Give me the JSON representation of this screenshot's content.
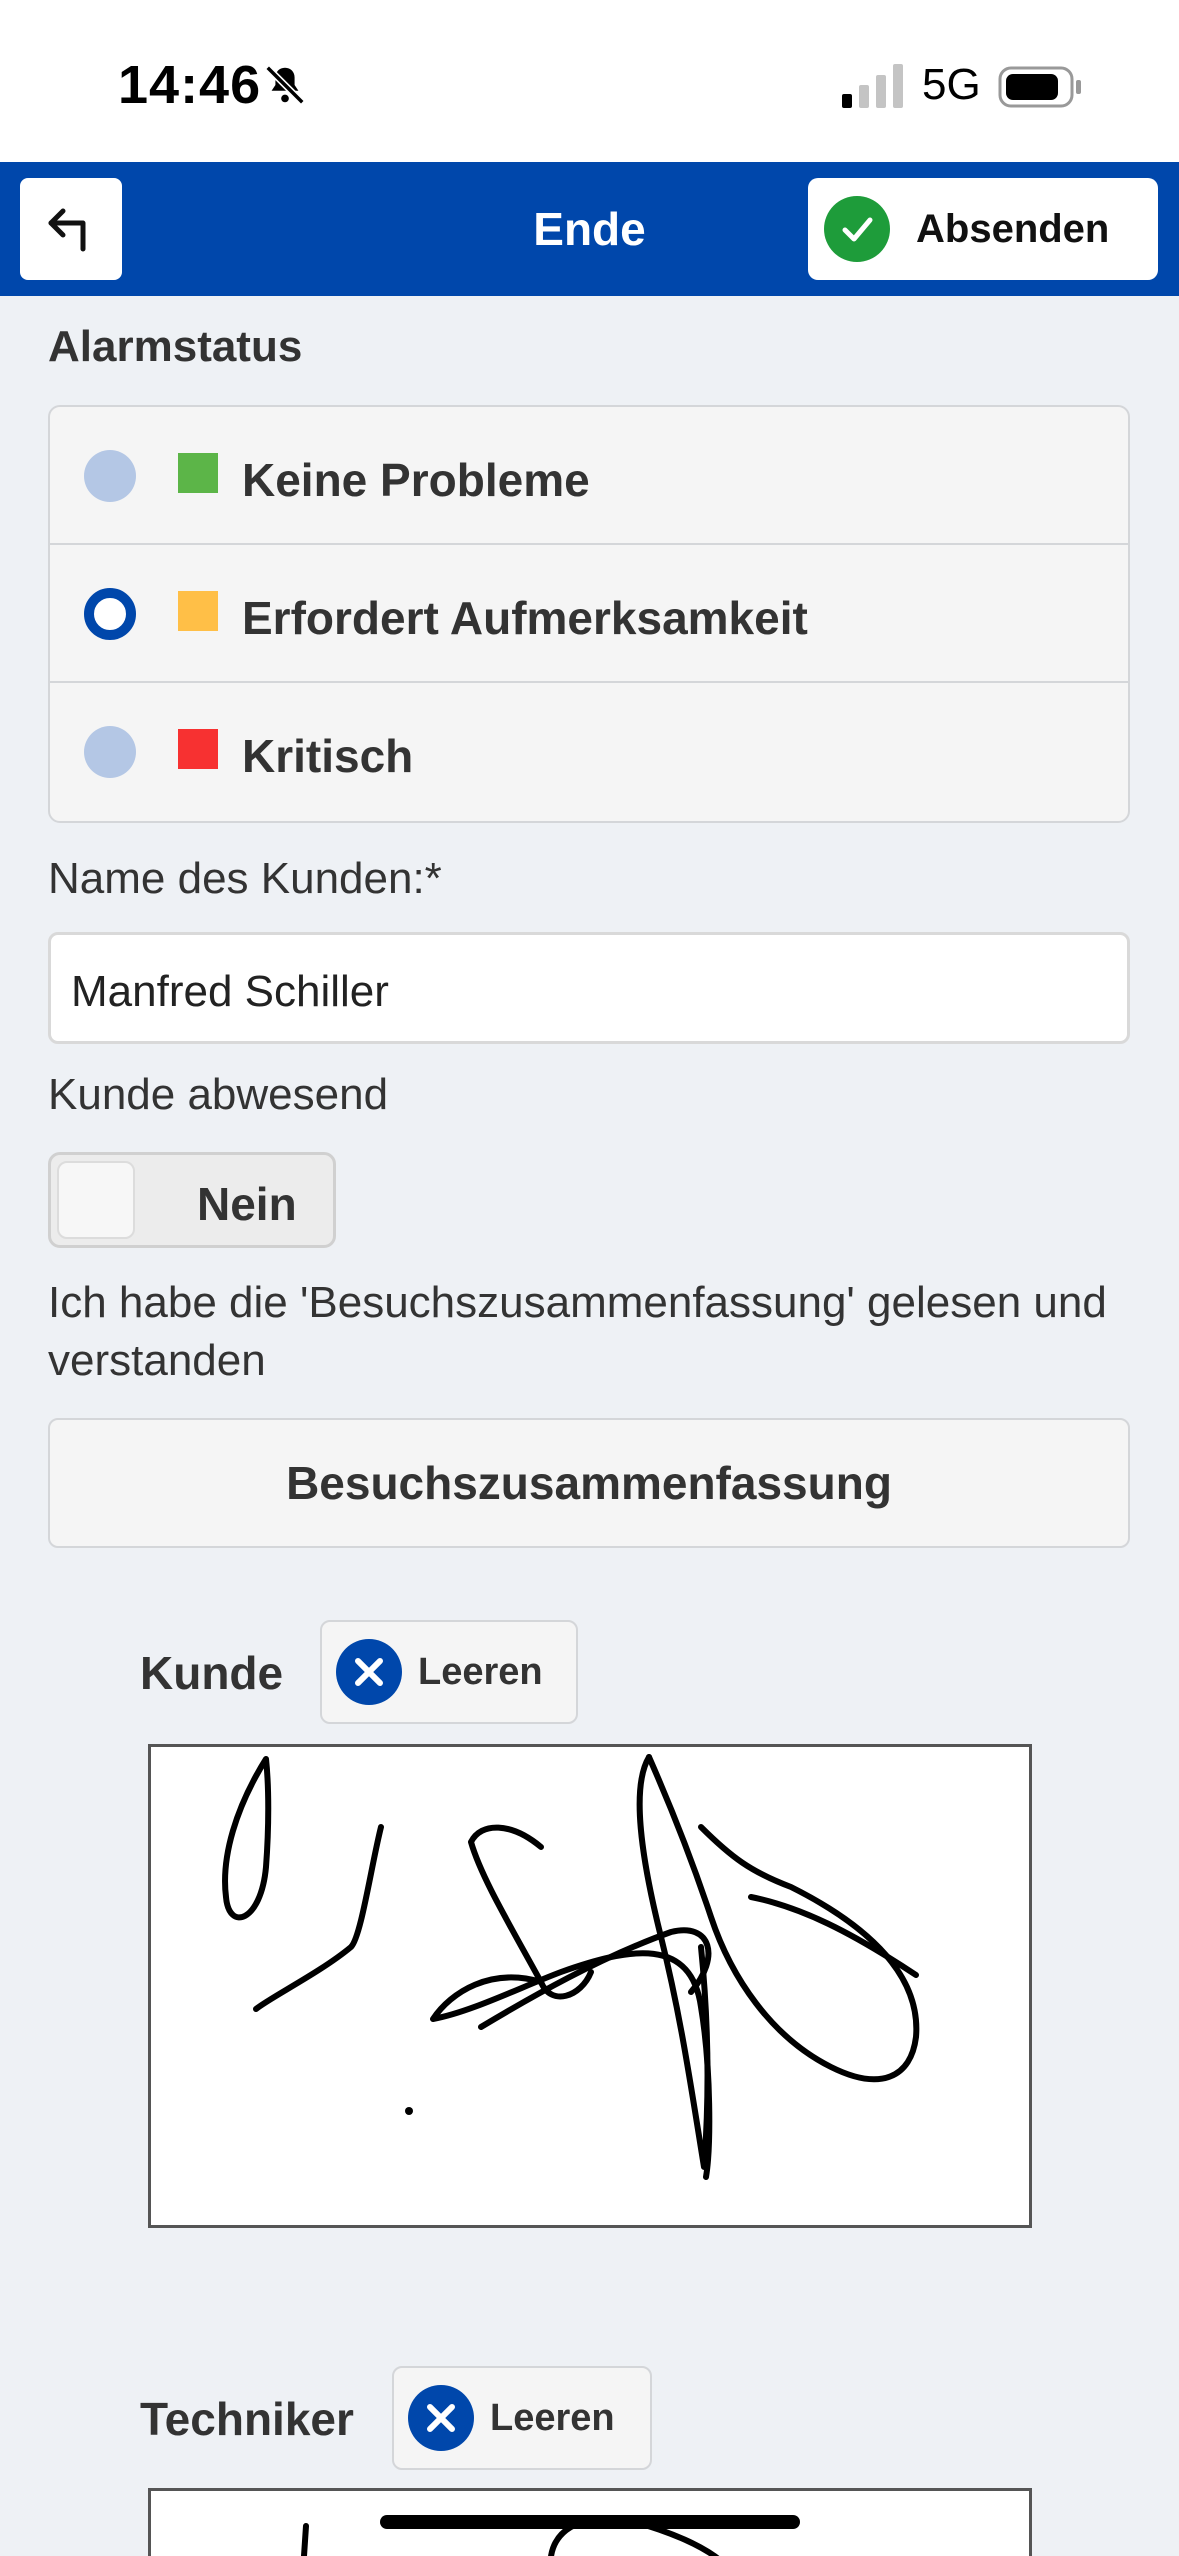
{
  "status_bar": {
    "time": "14:46",
    "network": "5G"
  },
  "header": {
    "title": "Ende",
    "send_label": "Absenden"
  },
  "alarm": {
    "label": "Alarmstatus",
    "options": [
      {
        "label": "Keine Probleme",
        "color": "#5cb548",
        "selected": false
      },
      {
        "label": "Erfordert Aufmerksamkeit",
        "color": "#ffbf47",
        "selected": true
      },
      {
        "label": "Kritisch",
        "color": "#f73131",
        "selected": false
      }
    ]
  },
  "customer_name": {
    "label": "Name des Kunden:*",
    "value": "Manfred Schiller"
  },
  "customer_absent": {
    "label": "Kunde abwesend",
    "toggle_label": "Nein"
  },
  "summary": {
    "statement": "Ich habe die 'Besuchszusammenfassung' gelesen und verstanden",
    "button_label": "Besuchszusammenfassung"
  },
  "signatures": {
    "customer": {
      "title": "Kunde",
      "clear_label": "Leeren"
    },
    "technician": {
      "title": "Techniker",
      "clear_label": "Leeren"
    }
  },
  "colors": {
    "header_blue": "#0047ab",
    "confirm_green": "#1e9c3a"
  }
}
